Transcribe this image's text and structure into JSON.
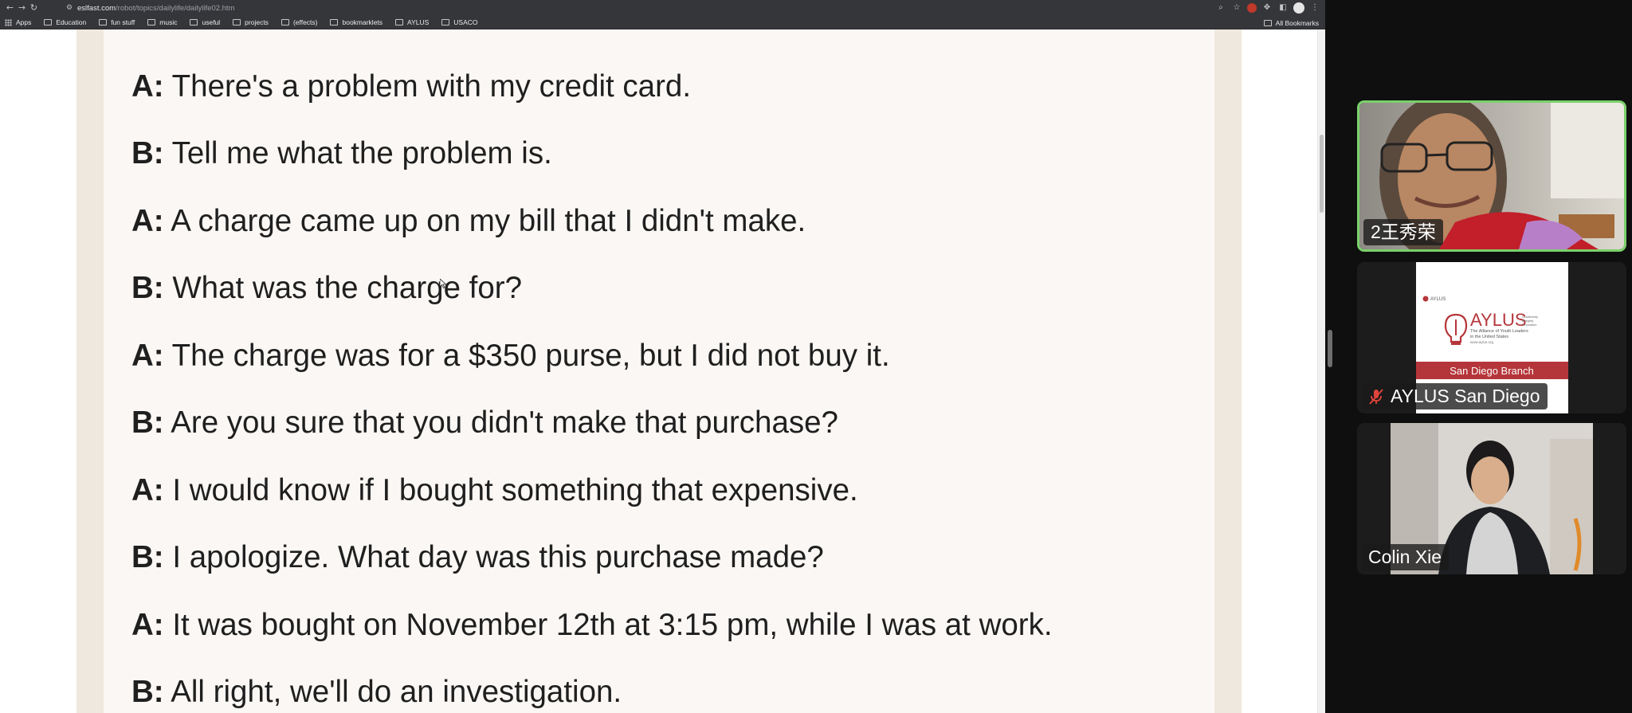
{
  "browser": {
    "url_host": "eslfast.com",
    "url_path": "/robot/topics/dailylife/dailylife02.htm",
    "bookmarks": [
      "Apps",
      "Education",
      "fun stuff",
      "music",
      "useful",
      "projects",
      "(effects)",
      "bookmarklets",
      "AYLUS",
      "USACO"
    ],
    "all_bookmarks": "All Bookmarks"
  },
  "dialogue": [
    {
      "speaker": "A:",
      "text": "There's a problem with my credit card."
    },
    {
      "speaker": "B:",
      "text": "Tell me what the problem is."
    },
    {
      "speaker": "A:",
      "text": "A charge came up on my bill that I didn't make."
    },
    {
      "speaker": "B:",
      "text": "What was the charge for?"
    },
    {
      "speaker": "A:",
      "text": "The charge was for a $350 purse, but I did not buy it."
    },
    {
      "speaker": "B:",
      "text": "Are you sure that you didn't make that purchase?"
    },
    {
      "speaker": "A:",
      "text": "I would know if I bought something that expensive."
    },
    {
      "speaker": "B:",
      "text": "I apologize. What day was this purchase made?"
    },
    {
      "speaker": "A:",
      "text": "It was bought on November 12th at 3:15 pm, while I was at work."
    },
    {
      "speaker": "B:",
      "text": "All right, we'll do an investigation."
    }
  ],
  "participants": [
    {
      "name": "2王秀荣",
      "active_speaker": true,
      "muted": false
    },
    {
      "name": "AYLUS San Diego",
      "active_speaker": false,
      "muted": true,
      "logo": {
        "brand": "AYLUS",
        "small_brand": "AYLUS",
        "tagline_lines": [
          "Leadership",
          "Integrity",
          "Innovation"
        ],
        "subtitle_lines": [
          "The Alliance of Youth Leaders",
          "in the United States"
        ],
        "website": "www.aylus.org",
        "branch": "San Diego Branch"
      }
    },
    {
      "name": "Colin Xie",
      "active_speaker": false,
      "muted": false
    }
  ],
  "colors": {
    "active_border": "#7ad16a",
    "muted_icon": "#e0433b",
    "aylus_red": "#b5363a"
  }
}
